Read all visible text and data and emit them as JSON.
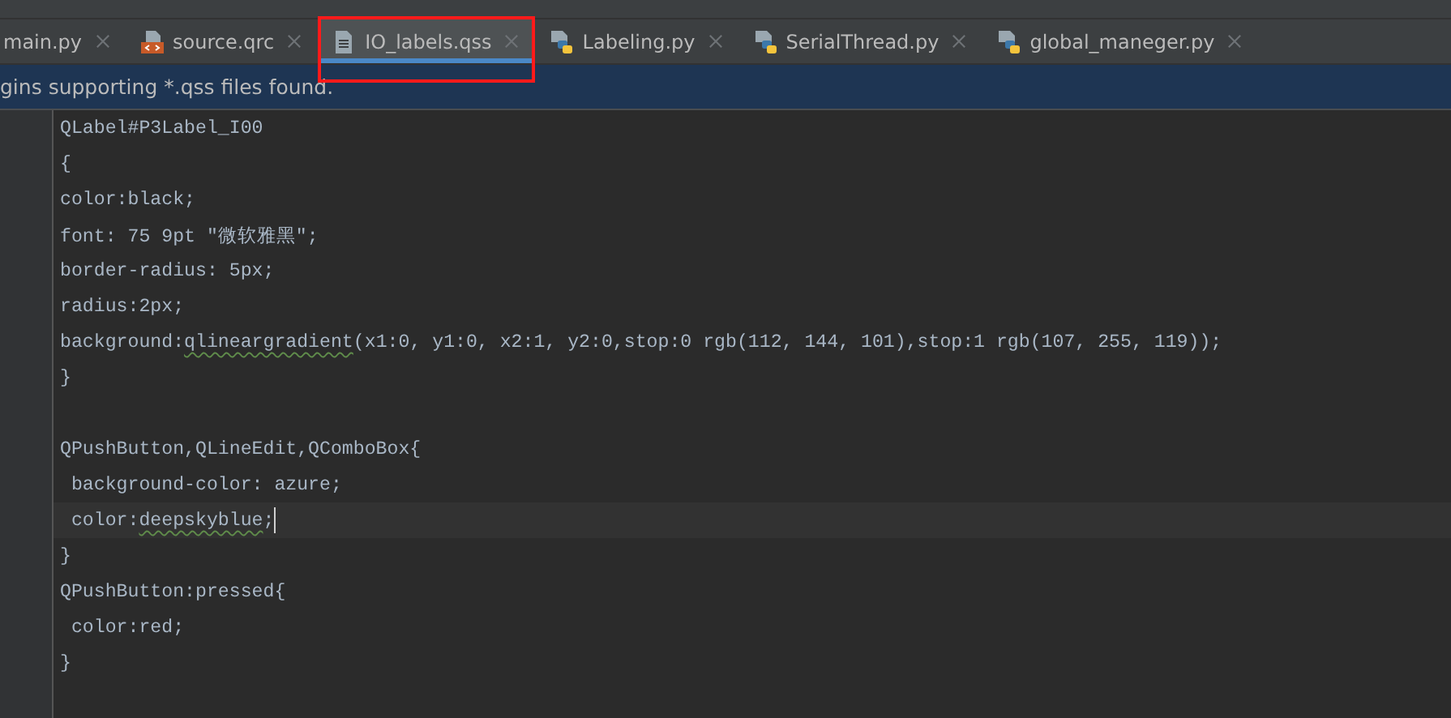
{
  "tabs": [
    {
      "label": "main.py",
      "kind": "python",
      "selected": false,
      "highlighted": false
    },
    {
      "label": "source.qrc",
      "kind": "qrc",
      "selected": false,
      "highlighted": false
    },
    {
      "label": "IO_labels.qss",
      "kind": "text",
      "selected": true,
      "highlighted": true
    },
    {
      "label": "Labeling.py",
      "kind": "python",
      "selected": false,
      "highlighted": false
    },
    {
      "label": "SerialThread.py",
      "kind": "python",
      "selected": false,
      "highlighted": false
    },
    {
      "label": "global_maneger.py",
      "kind": "python",
      "selected": false,
      "highlighted": false
    }
  ],
  "notification": "gins supporting *.qss files found.",
  "code_lines": [
    {
      "kind": "code",
      "current": false,
      "segments": [
        {
          "text": "QLabel#P3Label_I00",
          "warning": false
        }
      ]
    },
    {
      "kind": "code",
      "current": false,
      "segments": [
        {
          "text": "{",
          "warning": false
        }
      ]
    },
    {
      "kind": "code",
      "current": false,
      "segments": [
        {
          "text": "color:black;",
          "warning": false
        }
      ]
    },
    {
      "kind": "code",
      "current": false,
      "segments": [
        {
          "text": "font: 75 9pt \"微软雅黑\";",
          "warning": false
        }
      ]
    },
    {
      "kind": "code",
      "current": false,
      "segments": [
        {
          "text": "border-radius: 5px;",
          "warning": false
        }
      ]
    },
    {
      "kind": "code",
      "current": false,
      "segments": [
        {
          "text": "radius:2px;",
          "warning": false
        }
      ]
    },
    {
      "kind": "code",
      "current": false,
      "segments": [
        {
          "text": "background:",
          "warning": false
        },
        {
          "text": "qlineargradient",
          "warning": true
        },
        {
          "text": "(x1:0, y1:0, x2:1, y2:0,stop:0 rgb(112, 144, 101),stop:1 rgb(107, 255, 119));",
          "warning": false
        }
      ]
    },
    {
      "kind": "code",
      "current": false,
      "segments": [
        {
          "text": "}",
          "warning": false
        }
      ]
    },
    {
      "kind": "blank"
    },
    {
      "kind": "code",
      "current": false,
      "segments": [
        {
          "text": "QPushButton,QLineEdit,QComboBox{",
          "warning": false
        }
      ]
    },
    {
      "kind": "code",
      "current": false,
      "segments": [
        {
          "text": " background-color: azure;",
          "warning": false
        }
      ]
    },
    {
      "kind": "code",
      "current": true,
      "segments": [
        {
          "text": " color:",
          "warning": false
        },
        {
          "text": "deepskyblue",
          "warning": true
        },
        {
          "text": ";",
          "warning": false
        }
      ]
    },
    {
      "kind": "code",
      "current": false,
      "segments": [
        {
          "text": "}",
          "warning": false
        }
      ]
    },
    {
      "kind": "code",
      "current": false,
      "segments": [
        {
          "text": "QPushButton:pressed{",
          "warning": false
        }
      ]
    },
    {
      "kind": "code",
      "current": false,
      "segments": [
        {
          "text": " color:red;",
          "warning": false
        }
      ]
    },
    {
      "kind": "code",
      "current": false,
      "segments": [
        {
          "text": "}",
          "warning": false
        }
      ]
    }
  ]
}
